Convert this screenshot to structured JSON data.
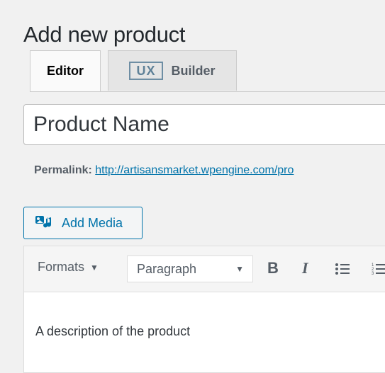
{
  "page": {
    "title": "Add new product"
  },
  "tabs": {
    "editor_label": "Editor",
    "ux_badge": "UX",
    "builder_label": "Builder"
  },
  "product": {
    "name_value": "Product Name"
  },
  "permalink": {
    "label": "Permalink:",
    "url": "http://artisansmarket.wpengine.com/pro"
  },
  "media": {
    "add_media_label": "Add Media"
  },
  "editor": {
    "formats_label": "Formats",
    "paragraph_value": "Paragraph",
    "bold_label": "B",
    "italic_label": "I",
    "content_text": "A description of the product"
  },
  "icons": {
    "formats_caret": "caret-down-icon",
    "paragraph_caret": "caret-down-icon",
    "bullet_list": "bullet-list-icon",
    "numbered_list": "numbered-list-icon",
    "add_media": "media-icon"
  },
  "colors": {
    "link": "#0073aa",
    "ux_badge": "#5f8198"
  }
}
